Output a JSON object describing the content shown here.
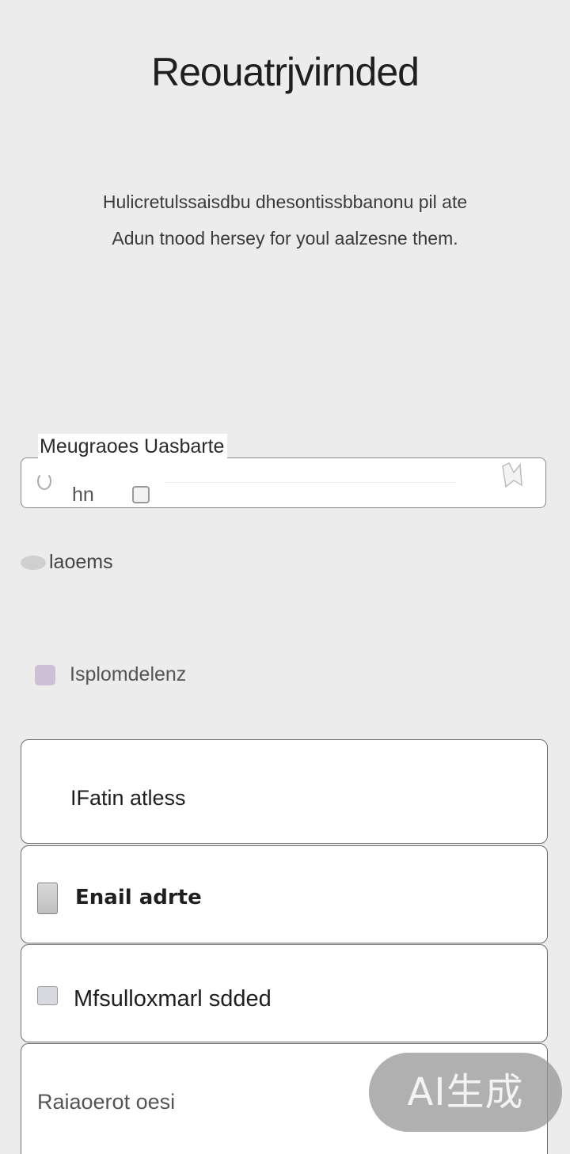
{
  "header": {
    "title": "Reouatrjvirnded",
    "subtitle_line1": "Hulicretulssaisdbu  dhesontissbbanonu pil ate",
    "subtitle_line2": "Adun tnood hersey for youl aalzesne them."
  },
  "form": {
    "field_label": "Meugraoes Uasbarte",
    "field_value": "hn",
    "helper_text": "laoems",
    "checkbox_label": "Isplomdelenz"
  },
  "options": [
    {
      "label": "IFatin atless"
    },
    {
      "label": "Enail adrte",
      "icon": "phone-icon"
    },
    {
      "label": "Mfsulloxmarl sdded",
      "icon": "image-icon"
    },
    {
      "label": "Raiaoerot oesi"
    }
  ],
  "watermark": {
    "text": "AI生成"
  },
  "colors": {
    "background": "#ececec",
    "checkbox": "#cdbfd6",
    "badge": "#969696"
  }
}
